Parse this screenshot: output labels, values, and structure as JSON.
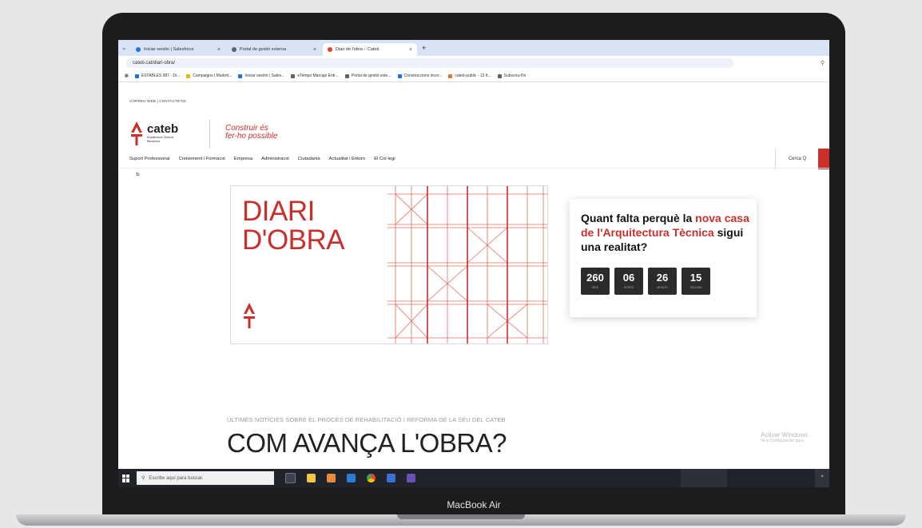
{
  "device": {
    "brand_label": "MacBook Air"
  },
  "browser": {
    "tabs": [
      {
        "title": "Iniciar sesión | Salesforce",
        "active": false
      },
      {
        "title": "Portal de gestió externa",
        "active": false
      },
      {
        "title": "Diari de l'obra – Cateb",
        "active": true
      }
    ],
    "url": "cateb.cat/diari-obra/",
    "bookmarks": [
      "ESTABLES 387 - Di...",
      "Campaigns | Mailchi...",
      "Iniciar sesión | Sales...",
      "eTempo Marcaje Entr...",
      "Portal de gestió exte...",
      "Construccions incor...",
      "cateb-public - 13 It...",
      "Subscriu-t'hi"
    ]
  },
  "site": {
    "topline": "CORREU WEB  |  CONTACTE'NS",
    "logo_name": "cateb",
    "logo_sub": "Arquitectura Tècnica Barcelona",
    "slogan_line1": "Construir és",
    "slogan_line2": "fer-ho possible",
    "nav": [
      "Suport Professional",
      "Creixement i Formació",
      "Empresa",
      "Administració",
      "Ciutadania",
      "Actualitat i Entorn",
      "El Col·legi"
    ],
    "search_label": "Cerca Q"
  },
  "banner": {
    "title_line1": "DIARI",
    "title_line2": "D'OBRA"
  },
  "countdown": {
    "headline_pre": "Quant falta perquè la ",
    "headline_hl": "nova casa de l'Arquitectura Tècnica",
    "headline_post": " sigui una realitat?",
    "units": [
      {
        "value": "260",
        "label": "DIES"
      },
      {
        "value": "06",
        "label": "HORES"
      },
      {
        "value": "26",
        "label": "MINUTS"
      },
      {
        "value": "15",
        "label": "SEGONS"
      }
    ]
  },
  "section": {
    "subhead": "ÚLTIMES NOTÍCIES SOBRE EL PROCÉS DE REHABILITACIÓ I REFORMA DE LA SEU DEL CATEB",
    "heading": "COM AVANÇA L'OBRA?"
  },
  "windows": {
    "activate_title": "Activar Windows",
    "activate_sub": "Ve a Configuración para",
    "search_placeholder": "Escribe aquí para buscar."
  },
  "colors": {
    "accent": "#c9302c",
    "timer_box": "#2b2b2b",
    "taskbar": "#20232a"
  }
}
